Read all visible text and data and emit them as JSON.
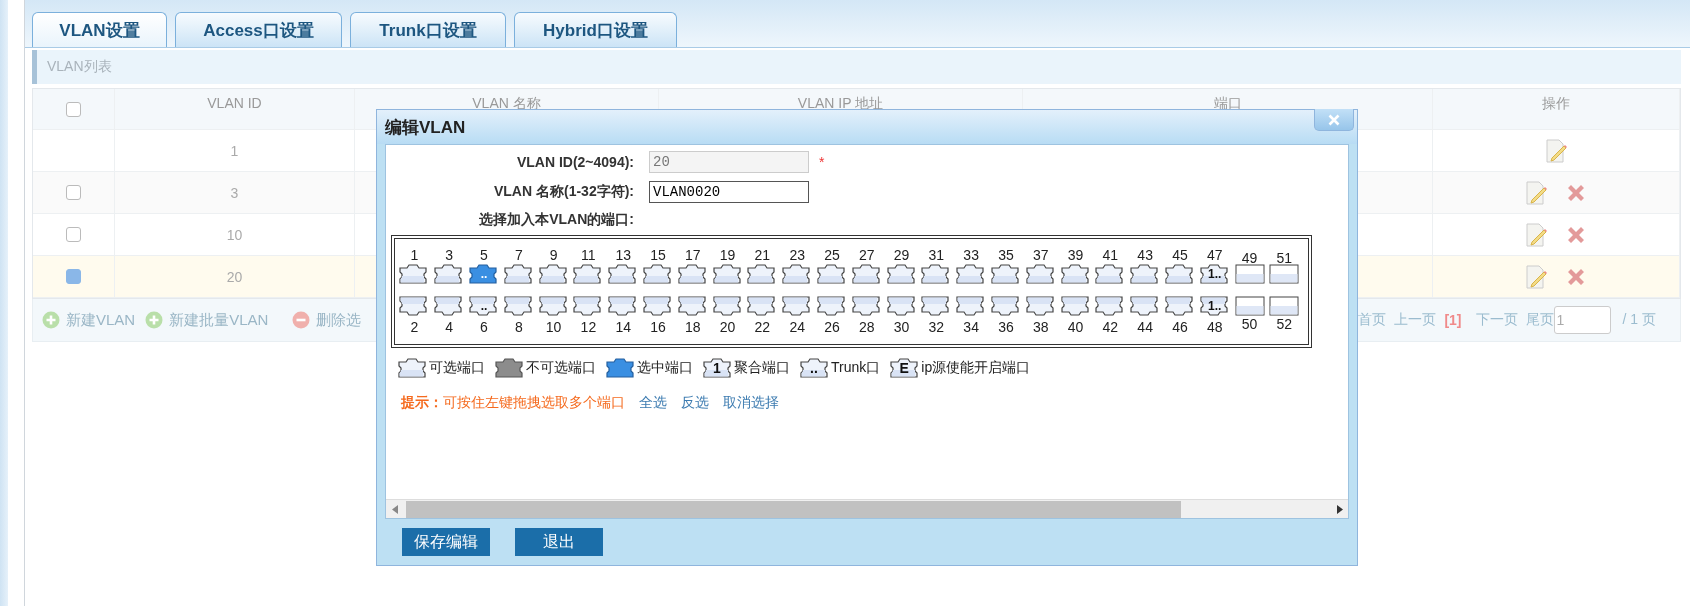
{
  "tabs": [
    {
      "label": "VLAN设置",
      "selected": true
    },
    {
      "label": "Access口设置",
      "selected": false
    },
    {
      "label": "Trunk口设置",
      "selected": false
    },
    {
      "label": "Hybrid口设置",
      "selected": false
    }
  ],
  "list_title": "VLAN列表",
  "table": {
    "header_checked": false,
    "columns": [
      "VLAN ID",
      "VLAN 名称",
      "VLAN IP 地址",
      "端口",
      "操作"
    ],
    "rows": [
      {
        "kind": "default",
        "id": "1"
      },
      {
        "kind": "user",
        "id": "3",
        "checked": false
      },
      {
        "kind": "user",
        "id": "10",
        "checked": false
      },
      {
        "kind": "user",
        "id": "20",
        "checked": true
      }
    ]
  },
  "toolbar": {
    "actions": [
      {
        "kind": "add",
        "label": "新建VLAN"
      },
      {
        "kind": "add",
        "label": "新建批量VLAN"
      },
      {
        "kind": "remove",
        "label": "删除选"
      }
    ],
    "pager": {
      "first": "首页",
      "prev": "上一页",
      "current": "[1]",
      "next": "下一页",
      "last": "尾页",
      "page_input": "1",
      "total": "/ 1 页"
    }
  },
  "dialog": {
    "title": "编辑VLAN",
    "fields": [
      {
        "label": "VLAN ID(2~4094):",
        "value": "20",
        "disabled": true,
        "required_mark": "*"
      },
      {
        "label": "VLAN 名称(1-32字符):",
        "value": "VLAN0020",
        "disabled": false
      }
    ],
    "ports_label": "选择加入本VLAN的端口:",
    "ports": [
      {
        "label": "1",
        "kind": "rj45",
        "selected": false
      },
      {
        "label": "2",
        "kind": "rj45",
        "selected": false
      },
      {
        "label": "3",
        "kind": "rj45",
        "selected": false
      },
      {
        "label": "4",
        "kind": "rj45",
        "selected": false
      },
      {
        "label": "5",
        "kind": "rj45",
        "selected": true,
        "mark": ".."
      },
      {
        "label": "6",
        "kind": "rj45",
        "selected": false,
        "mark": ".."
      },
      {
        "label": "7",
        "kind": "rj45",
        "selected": false
      },
      {
        "label": "8",
        "kind": "rj45",
        "selected": false
      },
      {
        "label": "9",
        "kind": "rj45",
        "selected": false
      },
      {
        "label": "10",
        "kind": "rj45",
        "selected": false
      },
      {
        "label": "11",
        "kind": "rj45",
        "selected": false
      },
      {
        "label": "12",
        "kind": "rj45",
        "selected": false
      },
      {
        "label": "13",
        "kind": "rj45",
        "selected": false
      },
      {
        "label": "14",
        "kind": "rj45",
        "selected": false
      },
      {
        "label": "15",
        "kind": "rj45",
        "selected": false
      },
      {
        "label": "16",
        "kind": "rj45",
        "selected": false
      },
      {
        "label": "17",
        "kind": "rj45",
        "selected": false
      },
      {
        "label": "18",
        "kind": "rj45",
        "selected": false
      },
      {
        "label": "19",
        "kind": "rj45",
        "selected": false
      },
      {
        "label": "20",
        "kind": "rj45",
        "selected": false
      },
      {
        "label": "21",
        "kind": "rj45",
        "selected": false
      },
      {
        "label": "22",
        "kind": "rj45",
        "selected": false
      },
      {
        "label": "23",
        "kind": "rj45",
        "selected": false
      },
      {
        "label": "24",
        "kind": "rj45",
        "selected": false
      },
      {
        "label": "25",
        "kind": "rj45",
        "selected": false
      },
      {
        "label": "26",
        "kind": "rj45",
        "selected": false
      },
      {
        "label": "27",
        "kind": "rj45",
        "selected": false
      },
      {
        "label": "28",
        "kind": "rj45",
        "selected": false
      },
      {
        "label": "29",
        "kind": "rj45",
        "selected": false
      },
      {
        "label": "30",
        "kind": "rj45",
        "selected": false
      },
      {
        "label": "31",
        "kind": "rj45",
        "selected": false
      },
      {
        "label": "32",
        "kind": "rj45",
        "selected": false
      },
      {
        "label": "33",
        "kind": "rj45",
        "selected": false
      },
      {
        "label": "34",
        "kind": "rj45",
        "selected": false
      },
      {
        "label": "35",
        "kind": "rj45",
        "selected": false
      },
      {
        "label": "36",
        "kind": "rj45",
        "selected": false
      },
      {
        "label": "37",
        "kind": "rj45",
        "selected": false
      },
      {
        "label": "38",
        "kind": "rj45",
        "selected": false
      },
      {
        "label": "39",
        "kind": "rj45",
        "selected": false
      },
      {
        "label": "40",
        "kind": "rj45",
        "selected": false
      },
      {
        "label": "41",
        "kind": "rj45",
        "selected": false
      },
      {
        "label": "42",
        "kind": "rj45",
        "selected": false
      },
      {
        "label": "43",
        "kind": "rj45",
        "selected": false
      },
      {
        "label": "44",
        "kind": "rj45",
        "selected": false
      },
      {
        "label": "45",
        "kind": "rj45",
        "selected": false
      },
      {
        "label": "46",
        "kind": "rj45",
        "selected": false
      },
      {
        "label": "47",
        "kind": "rj45",
        "selected": false,
        "mark": "1.."
      },
      {
        "label": "48",
        "kind": "rj45",
        "selected": false,
        "mark": "1.."
      },
      {
        "label": "49",
        "kind": "sfp",
        "selected": false
      },
      {
        "label": "50",
        "kind": "sfp",
        "selected": false
      },
      {
        "label": "51",
        "kind": "sfp",
        "selected": false
      },
      {
        "label": "52",
        "kind": "sfp",
        "selected": false
      }
    ],
    "legend": [
      {
        "kind": "available",
        "label": "可选端口"
      },
      {
        "kind": "unavailable",
        "label": "不可选端口"
      },
      {
        "kind": "selected",
        "label": "选中端口"
      },
      {
        "kind": "aggregate",
        "mark": "1",
        "label": "聚合端口"
      },
      {
        "kind": "trunk",
        "mark": "..",
        "label": "Trunk口"
      },
      {
        "kind": "ip_source",
        "mark": "E",
        "label": "ip源使能开启端口"
      }
    ],
    "hint": "**提示：**可按住左键拖拽选取多个端口",
    "links": [
      "全选",
      "反选",
      "取消选择"
    ],
    "buttons": [
      "保存编辑",
      "退出"
    ]
  }
}
